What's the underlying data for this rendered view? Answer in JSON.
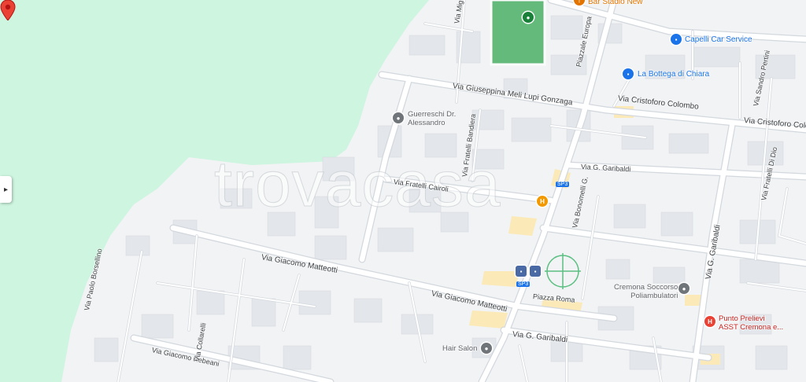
{
  "map": {
    "watermark": "trovacasa",
    "colors": {
      "background": "#f1f3f4",
      "park": "#cdf5df",
      "road": "#ffffff",
      "road_outline": "#d3d8de",
      "block": "#e3e6ea",
      "highlight": "#fbe9b7",
      "marker": "#ea4335"
    },
    "roads": {
      "via_giuseppina": "Via Giuseppina Meli Lupi Gonzaga",
      "via_cristoforo_1": "Via Cristoforo Colombo",
      "via_cristoforo_2": "Via Cristoforo Colo",
      "via_fratelli_cairoli": "Via Fratelli Cairoli",
      "via_fratelli_bandiera": "Via Fratelli Bandiera",
      "via_g_garibaldi_1": "Via G. Garibaldi",
      "via_g_garibaldi_2": "Via G. Garibaldi",
      "via_g_garibaldi_3": "Via G. Garibaldi",
      "via_giacomo_matteotti_1": "Via Giacomo Matteotti",
      "via_giacomo_matteotti_2": "Via Giacomo Matteotti",
      "via_paolo_borsellino": "Via Paolo Borsellino",
      "via_giacomo_rebeani": "Via Giacomo Rebeani",
      "via_collarelli": "Via Collarelli",
      "via_bonomelli": "Via Bonomelli G.",
      "piazzale_europa": "Piazzale Europa",
      "piazza_roma": "Piazza Roma",
      "via_sandro_pertini": "Via Sandro Pertini",
      "via_fratelli_di_dio": "Via Fratelli Di Dio",
      "via_mig": "Via Mig",
      "sp3_1": "SP3",
      "sp3_2": "SP3"
    },
    "pois": {
      "bar_stadio": "Bar Stadio New",
      "capelli": "Capelli Car Service",
      "bottega": "La Bottega di Chiara",
      "guerreschi_1": "Guerreschi Dr.",
      "guerreschi_2": "Alessandro",
      "cremona_1": "Cremona Soccorso",
      "cremona_2": "Poliambulatori",
      "punto_1": "Punto Prelievi",
      "punto_2": "ASST Cremona e...",
      "hair_salon": "Hair Salon"
    },
    "icons": {
      "side_toggle": "▸",
      "hotel": "H",
      "hospital": "H"
    }
  }
}
